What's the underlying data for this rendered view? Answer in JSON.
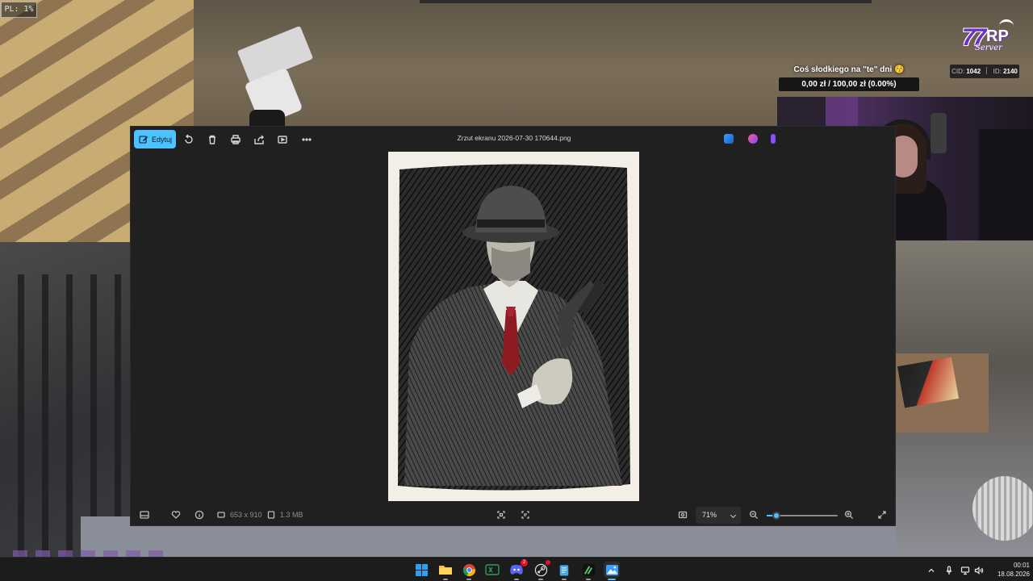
{
  "debug": {
    "pl_label": "PL: 1%"
  },
  "overlay": {
    "logo": {
      "number": "77",
      "rp": "RP",
      "subtitle": "Server"
    },
    "goal_title": "Coś słodkiego na \"te\" dni 😚",
    "goal_amount": "0,00 zł / 100,00 zł (0.00%)",
    "goal_progress_fraction": 0.0,
    "goal_fill_color": "#7a3cff",
    "cid_label": "CID:",
    "cid_value": "1042",
    "id_label": "ID:",
    "id_value": "2140"
  },
  "photos": {
    "edit_label": "Edytuj",
    "title": "Zrzut ekranu 2026-07-30 170644.png",
    "toolbar_icons": [
      "rotate-icon",
      "delete-icon",
      "print-icon",
      "share-icon",
      "slideshow-icon",
      "more-icon"
    ],
    "dimensions": "653 x 910",
    "file_size": "1.3 MB",
    "zoom_value": "71%",
    "zoom_fraction": 0.14,
    "accent_color": "#4cc2ff"
  },
  "taskbar": {
    "apps": [
      "start-icon",
      "file-explorer-icon",
      "chrome-icon",
      "excel-icon",
      "discord-icon",
      "steam-icon",
      "notepad-icon",
      "game-icon",
      "photos-icon"
    ],
    "discord_badge": "2",
    "time": "00:01",
    "date": "18.08.2026"
  }
}
